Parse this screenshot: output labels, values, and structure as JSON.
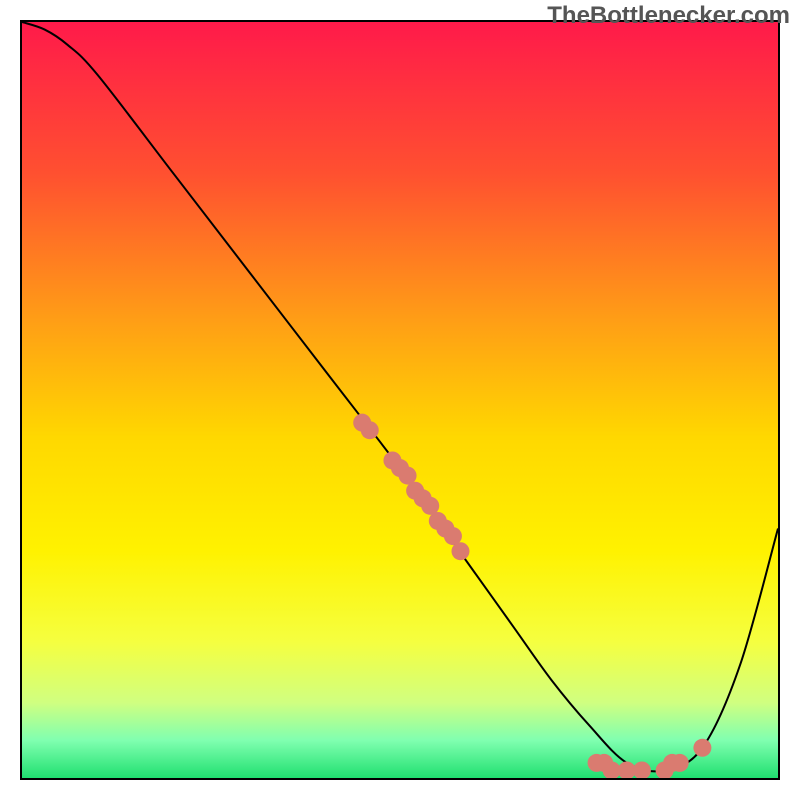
{
  "watermark": "TheBottlenecker.com",
  "chart_data": {
    "type": "line",
    "title": "",
    "xlabel": "",
    "ylabel": "",
    "xlim": [
      0,
      100
    ],
    "ylim": [
      0,
      100
    ],
    "series": [
      {
        "name": "curve",
        "x": [
          0,
          3,
          6,
          10,
          20,
          30,
          40,
          50,
          55,
          60,
          65,
          70,
          75,
          80,
          85,
          90,
          95,
          100
        ],
        "y": [
          100,
          99,
          97,
          93,
          80,
          67,
          54,
          41,
          34,
          27,
          20,
          13,
          7,
          2,
          1,
          4,
          15,
          33
        ]
      }
    ],
    "scatter_points": {
      "name": "dots",
      "x": [
        45,
        46,
        49,
        50,
        51,
        52,
        53,
        54,
        55,
        56,
        57,
        58,
        76,
        77,
        78,
        80,
        82,
        85,
        86,
        87,
        90
      ],
      "y": [
        47,
        46,
        42,
        41,
        40,
        38,
        37,
        36,
        34,
        33,
        32,
        30,
        2,
        2,
        1,
        1,
        1,
        1,
        2,
        2,
        4
      ]
    },
    "background": {
      "type": "vertical-gradient",
      "stops": [
        {
          "offset": 0.0,
          "color": "#ff1a4a"
        },
        {
          "offset": 0.2,
          "color": "#ff5030"
        },
        {
          "offset": 0.4,
          "color": "#ffa015"
        },
        {
          "offset": 0.55,
          "color": "#ffd800"
        },
        {
          "offset": 0.7,
          "color": "#fff200"
        },
        {
          "offset": 0.82,
          "color": "#f5ff40"
        },
        {
          "offset": 0.9,
          "color": "#d0ff80"
        },
        {
          "offset": 0.95,
          "color": "#80ffb0"
        },
        {
          "offset": 1.0,
          "color": "#20e070"
        }
      ]
    }
  }
}
